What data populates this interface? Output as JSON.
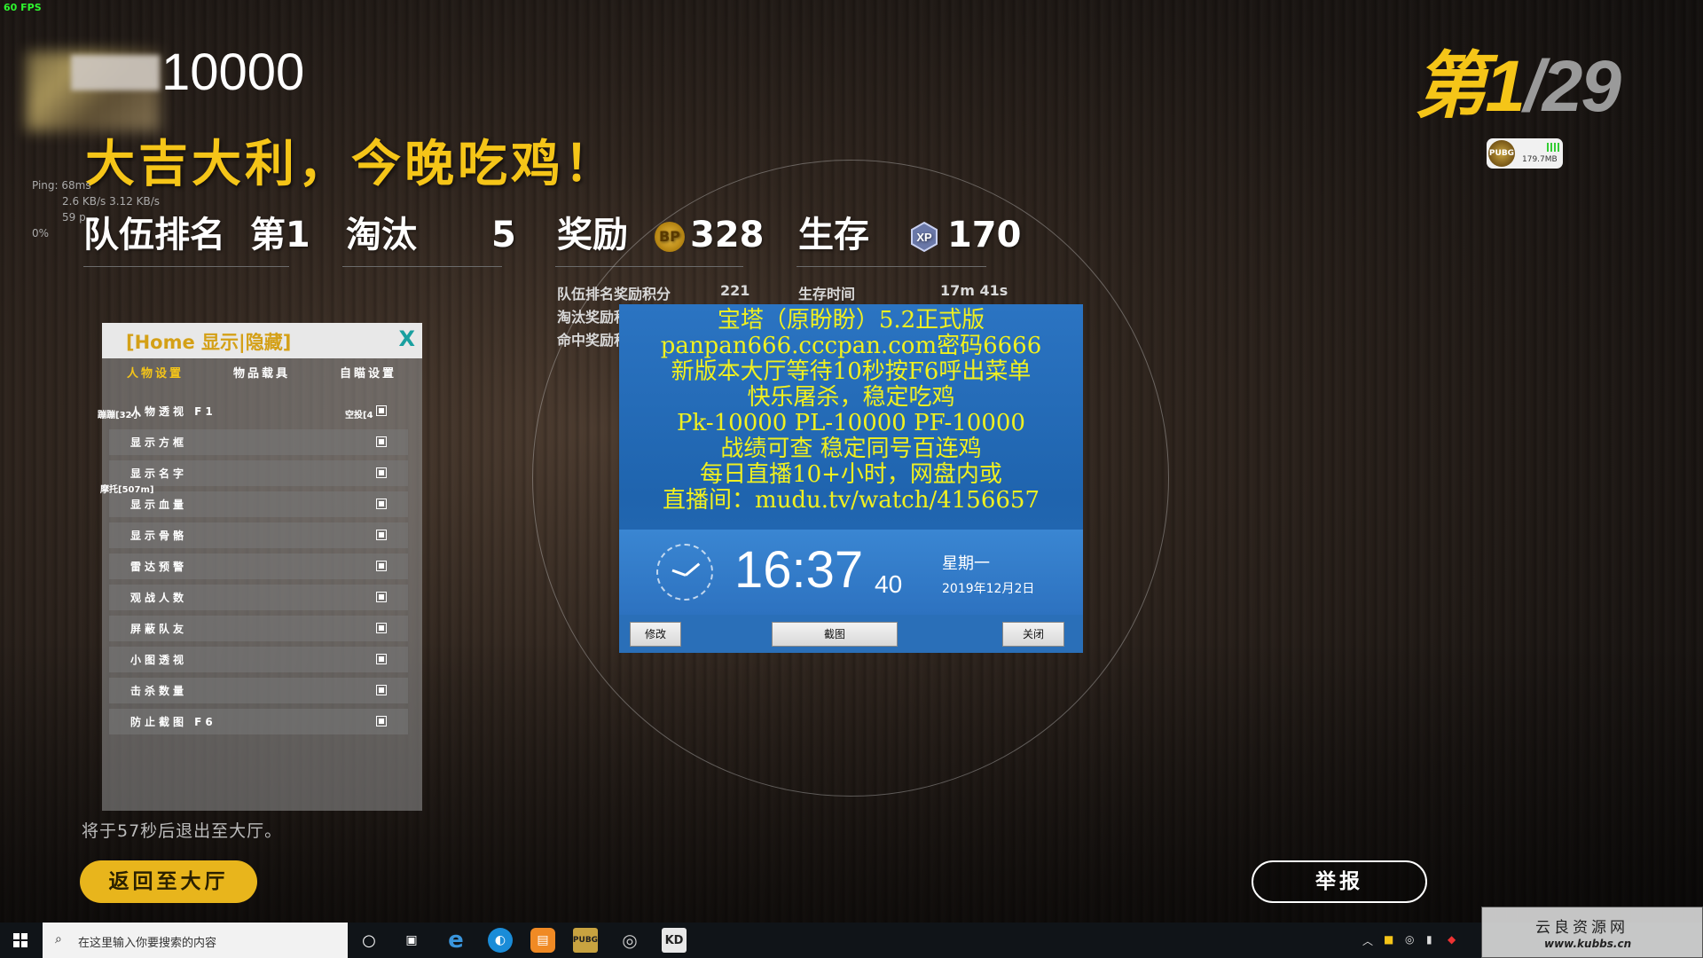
{
  "hud": {
    "fps": "60 FPS",
    "score": "10000",
    "slogan": "大吉大利，今晚吃鸡！",
    "net_stats": [
      "Ping: 68ms",
      "2.6 KB/s   3.12 KB/s",
      "59 p",
      "0%"
    ],
    "rank_current": "第1",
    "rank_total": "/29",
    "badge_logo": "PUBG",
    "badge_size": "179.7MB"
  },
  "stats": {
    "team_rank_label": "队伍排名",
    "team_rank_value": "第1",
    "kills_label": "淘汰",
    "kills_value": "5",
    "reward_label": "奖励",
    "reward_value": "328",
    "survival_label": "生存",
    "survival_value": "170",
    "xp_icon_text": "XP",
    "rank_points_label": "队伍排名奖励积分",
    "rank_points_value": "221",
    "kill_points_label": "淘汰奖励积分",
    "hit_points_label": "命中奖励积分",
    "survival_time_label": "生存时间",
    "survival_time_value": "17m 41s"
  },
  "menu": {
    "title": "[Home 显示|隐藏]",
    "close": "X",
    "tabs": [
      "人物设置",
      "物品载具",
      "自瞄设置"
    ],
    "items": [
      {
        "label": "人物透视 F1"
      },
      {
        "label": "显示方框"
      },
      {
        "label": "显示名字"
      },
      {
        "label": "显示血量"
      },
      {
        "label": "显示骨骼"
      },
      {
        "label": "雷达预警"
      },
      {
        "label": "观战人数"
      },
      {
        "label": "屏蔽队友"
      },
      {
        "label": "小图透视"
      },
      {
        "label": "击杀数量"
      },
      {
        "label": "防止截图 F6"
      }
    ],
    "overlay_left": "蹦蹦[32小",
    "overlay_right": "空投[4",
    "overlay_moto": "摩托[507m]"
  },
  "ad": {
    "lines": [
      "宝塔（原盼盼）5.2正式版",
      "panpan666.cccpan.com密码6666",
      "新版本大厅等待10秒按F6呼出菜单",
      "快乐屠杀，稳定吃鸡",
      "Pk-10000 PL-10000 PF-10000",
      "战绩可查 稳定同号百连鸡",
      "每日直播10+小时，网盘内或",
      "直播间：mudu.tv/watch/4156657"
    ],
    "time": "16:37",
    "seconds": "40",
    "weekday": "星期一",
    "date": "2019年12月2日",
    "btn_modify": "修改",
    "btn_screenshot": "截图",
    "btn_close": "关闭"
  },
  "bottom": {
    "exit_message": "将于57秒后退出至大厅。",
    "lobby_button": "返回至大厅",
    "report_button": "举报",
    "watermark_title": "云良资源网",
    "watermark_url": "www.kubbs.cn"
  },
  "taskbar": {
    "search_placeholder": "在这里输入你要搜索的内容",
    "app_pubg_label": "PUBG",
    "app_kd_label": "KD"
  },
  "colors": {
    "accent_yellow": "#f5c518",
    "ad_blue": "#2b74c2",
    "ad_text": "#f0f020"
  }
}
